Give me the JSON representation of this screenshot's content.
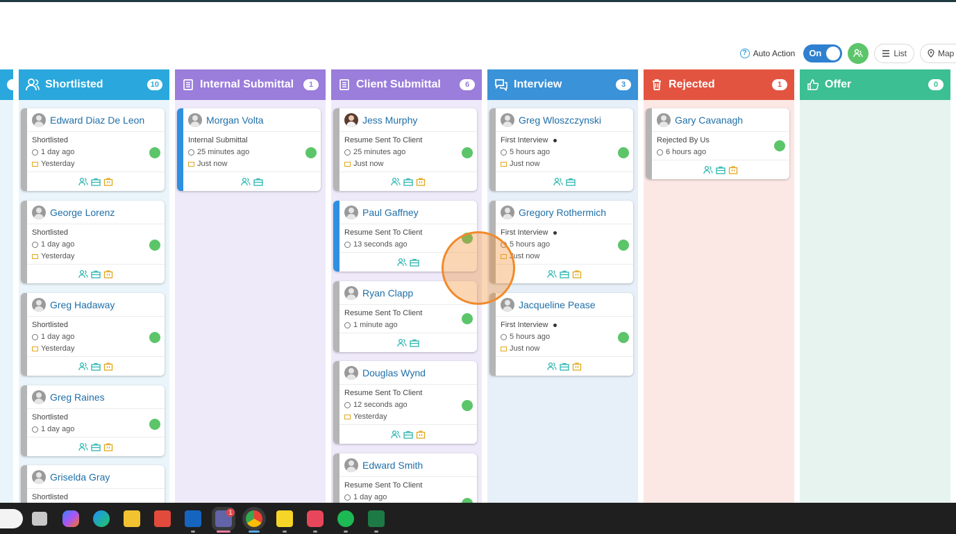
{
  "toolbar": {
    "auto_action_label": "Auto Action",
    "toggle_label": "On",
    "list_label": "List",
    "map_label": "Map"
  },
  "columns": [
    {
      "title": "Shortlisted",
      "count": "10",
      "color": "#2aa8dd",
      "bg": "#eaf5fb"
    },
    {
      "title": "Internal Submittal",
      "count": "1",
      "color": "#9b7ddb",
      "bg": "#efeafa"
    },
    {
      "title": "Client Submittal",
      "count": "6",
      "color": "#9b7ddb",
      "bg": "#efeafa"
    },
    {
      "title": "Interview",
      "count": "3",
      "color": "#3a92d8",
      "bg": "#e7eff8"
    },
    {
      "title": "Rejected",
      "count": "1",
      "color": "#e35440",
      "bg": "#fbe8e5"
    },
    {
      "title": "Offer",
      "count": "0",
      "color": "#3cbf93",
      "bg": "#e6f3ee"
    }
  ],
  "cards": {
    "shortlisted": [
      {
        "name": "Edward Diaz De Leon",
        "status": "Shortlisted",
        "time": "1 day ago",
        "mail": "Yesterday"
      },
      {
        "name": "George Lorenz",
        "status": "Shortlisted",
        "time": "1 day ago",
        "mail": "Yesterday"
      },
      {
        "name": "Greg Hadaway",
        "status": "Shortlisted",
        "time": "1 day ago",
        "mail": "Yesterday"
      },
      {
        "name": "Greg Raines",
        "status": "Shortlisted",
        "time": "1 day ago"
      },
      {
        "name": "Griselda Gray",
        "status": "Shortlisted"
      }
    ],
    "internal": [
      {
        "name": "Morgan Volta",
        "status": "Internal Submittal",
        "time": "25 minutes ago",
        "mail": "Just now"
      }
    ],
    "client": [
      {
        "name": "Jess Murphy",
        "status": "Resume Sent To Client",
        "time": "25 minutes ago",
        "mail": "Just now"
      },
      {
        "name": "Paul Gaffney",
        "status": "Resume Sent To Client",
        "time": "13 seconds ago"
      },
      {
        "name": "Ryan Clapp",
        "status": "Resume Sent To Client",
        "time": "1 minute ago"
      },
      {
        "name": "Douglas Wynd",
        "status": "Resume Sent To Client",
        "time": "12 seconds ago",
        "mail": "Yesterday"
      },
      {
        "name": "Edward Smith",
        "status": "Resume Sent To Client",
        "time": "1 day ago"
      }
    ],
    "interview": [
      {
        "name": "Greg Wloszczynski",
        "status": "First Interview",
        "time": "5 hours ago",
        "mail": "Just now"
      },
      {
        "name": "Gregory Rothermich",
        "status": "First Interview",
        "time": "5 hours ago",
        "mail": "Just now"
      },
      {
        "name": "Jacqueline Pease",
        "status": "First Interview",
        "time": "5 hours ago",
        "mail": "Just now"
      }
    ],
    "rejected": [
      {
        "name": "Gary Cavanagh",
        "status": "Rejected By Us",
        "time": "6 hours ago"
      }
    ]
  },
  "taskbar_badge": "1",
  "colors": {
    "teal": "#2bb5b0",
    "gold": "#e2a71a",
    "green": "#5cc56a"
  }
}
